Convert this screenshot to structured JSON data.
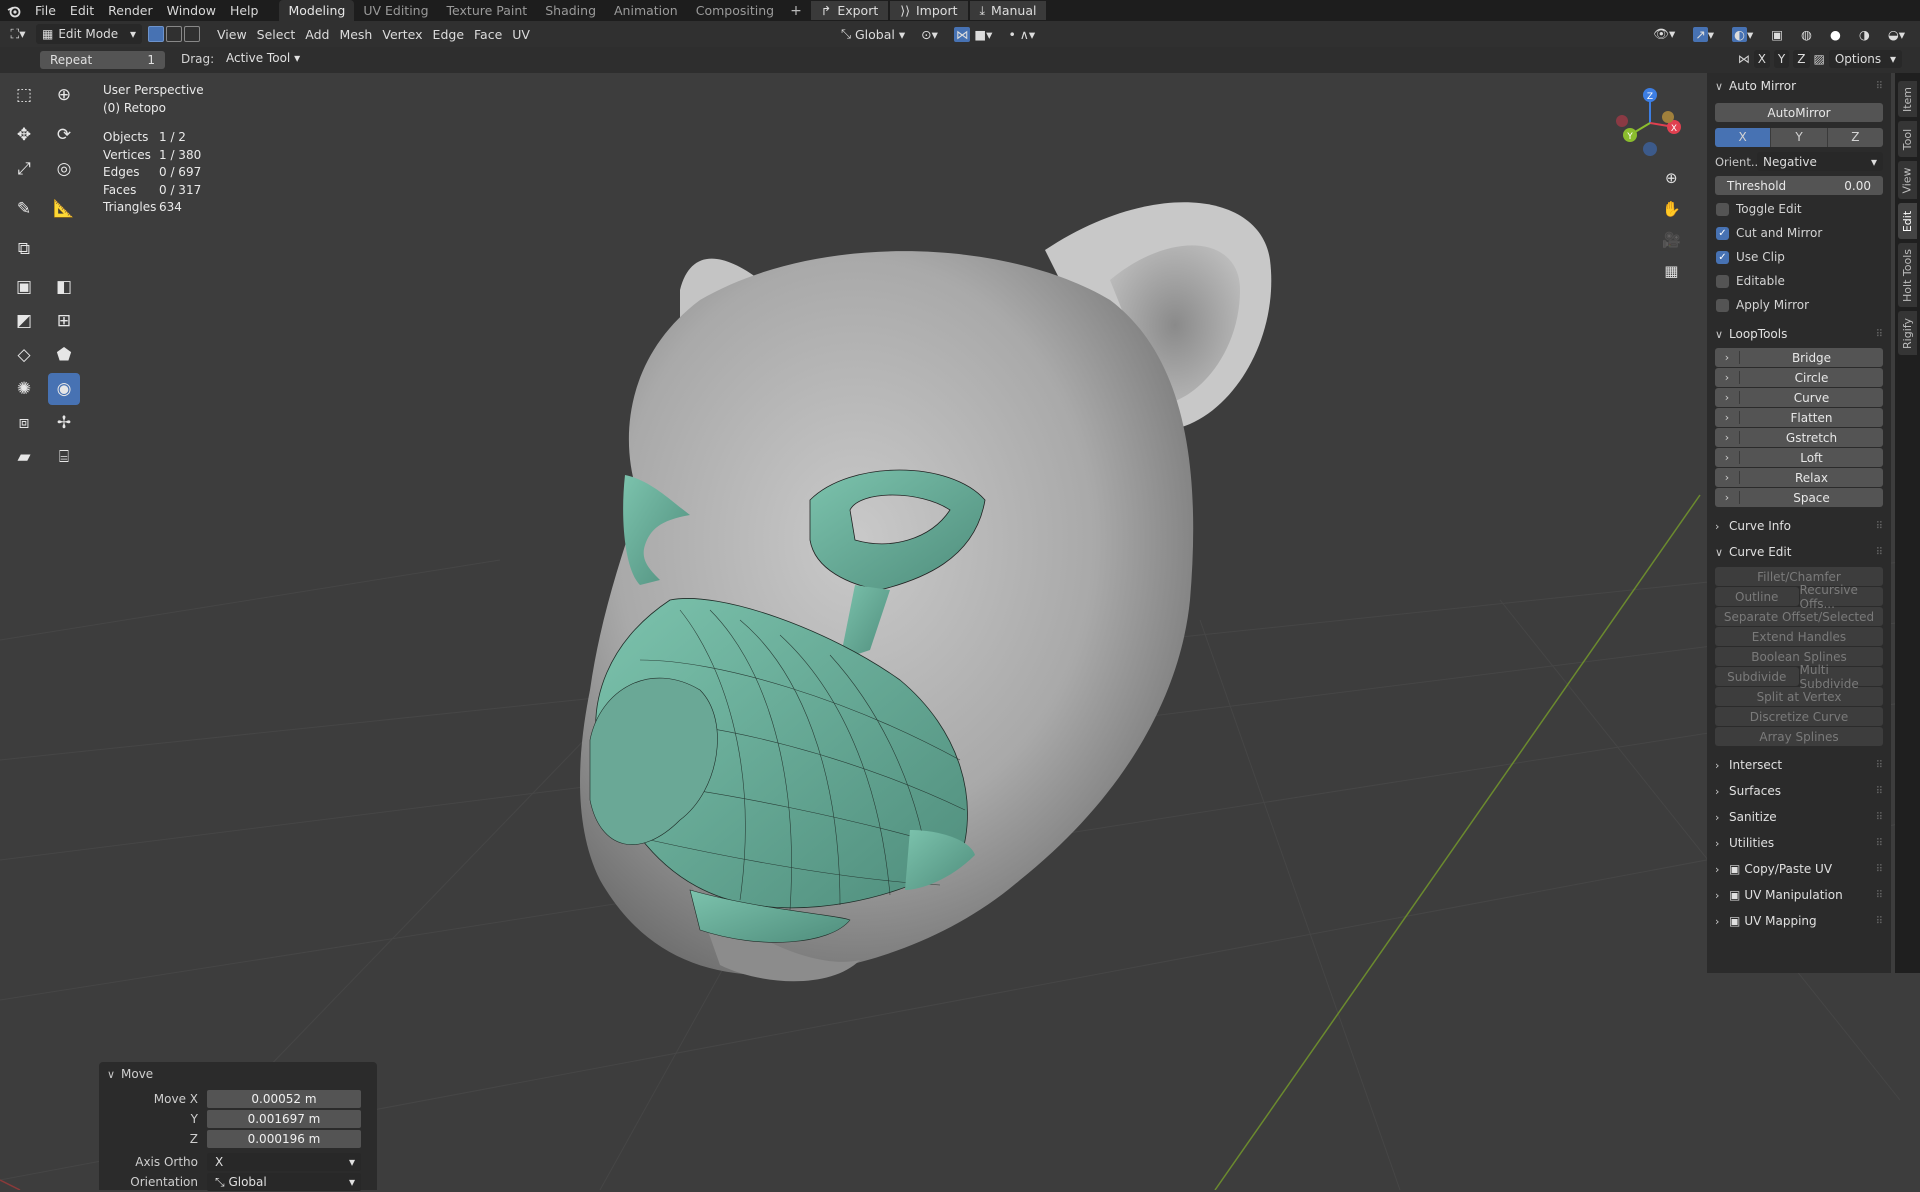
{
  "topbar": {
    "menus": [
      "File",
      "Edit",
      "Render",
      "Window",
      "Help"
    ],
    "workspaces": [
      "Modeling",
      "UV Editing",
      "Texture Paint",
      "Shading",
      "Animation",
      "Compositing"
    ],
    "active_workspace": "Modeling",
    "plus": "+",
    "export_label": "Export",
    "import_label": "Import",
    "manual_label": "Manual"
  },
  "header": {
    "mode": "Edit Mode",
    "menus": [
      "View",
      "Select",
      "Add",
      "Mesh",
      "Vertex",
      "Edge",
      "Face",
      "UV"
    ],
    "transform_orientation": "Global",
    "options_label": "Options",
    "axis_labels": [
      "X",
      "Y",
      "Z"
    ]
  },
  "optbar": {
    "repeat_label": "Repeat",
    "repeat_value": "1",
    "drag_label": "Drag:",
    "drag_value": "Active Tool"
  },
  "overlay": {
    "view_name": "User Perspective",
    "object_name": "(0) Retopo",
    "stats": [
      {
        "k": "Objects",
        "v": "1 / 2"
      },
      {
        "k": "Vertices",
        "v": "1 / 380"
      },
      {
        "k": "Edges",
        "v": "0 / 697"
      },
      {
        "k": "Faces",
        "v": "0 / 317"
      },
      {
        "k": "Triangles",
        "v": "634"
      }
    ]
  },
  "gizmo": {
    "x": "X",
    "y": "Y",
    "z": "Z"
  },
  "npanel": {
    "auto_mirror": {
      "title": "Auto Mirror",
      "button": "AutoMirror",
      "axes": [
        "X",
        "Y",
        "Z"
      ],
      "active_axis": "X",
      "orient_label": "Orient...",
      "orient_value": "Negative",
      "threshold_label": "Threshold",
      "threshold_value": "0.00",
      "toggles": [
        {
          "label": "Toggle Edit",
          "checked": false
        },
        {
          "label": "Cut and Mirror",
          "checked": true
        },
        {
          "label": "Use Clip",
          "checked": true
        },
        {
          "label": "Editable",
          "checked": false
        },
        {
          "label": "Apply Mirror",
          "checked": false
        }
      ]
    },
    "looptools": {
      "title": "LoopTools",
      "items": [
        "Bridge",
        "Circle",
        "Curve",
        "Flatten",
        "Gstretch",
        "Loft",
        "Relax",
        "Space"
      ]
    },
    "curve_info": "Curve Info",
    "curve_edit": {
      "title": "Curve Edit",
      "rows": [
        [
          "Fillet/Chamfer"
        ],
        [
          "Outline",
          "Recursive Offs..."
        ],
        [
          "Separate Offset/Selected"
        ],
        [
          "Extend Handles"
        ],
        [
          "Boolean Splines"
        ],
        [
          "Subdivide",
          "Multi Subdivide"
        ],
        [
          "Split at Vertex"
        ],
        [
          "Discretize Curve"
        ],
        [
          "Array Splines"
        ]
      ]
    },
    "collapsed": [
      "Intersect",
      "Surfaces",
      "Sanitize",
      "Utilities"
    ],
    "addons": [
      "Copy/Paste UV",
      "UV Manipulation",
      "UV Mapping"
    ]
  },
  "tabs": [
    "Item",
    "Tool",
    "View",
    "Edit",
    "Holt Tools",
    "Rigify"
  ],
  "move_panel": {
    "title": "Move",
    "rows": [
      {
        "label": "Move X",
        "value": "0.00052 m"
      },
      {
        "label": "Y",
        "value": "0.001697 m"
      },
      {
        "label": "Z",
        "value": "0.000196 m"
      }
    ],
    "axis_ortho_label": "Axis Ortho",
    "axis_ortho_value": "X",
    "orientation_label": "Orientation",
    "orientation_value": "Global"
  },
  "colors": {
    "accent": "#4772b3",
    "mesh": "#6fb5a0",
    "bg": "#3d3d3d"
  }
}
